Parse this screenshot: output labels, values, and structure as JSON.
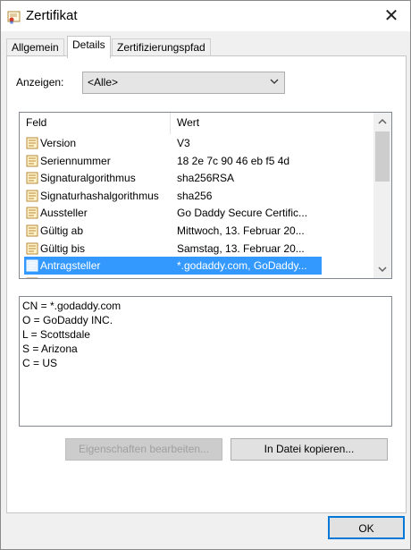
{
  "window": {
    "title": "Zertifikat",
    "close_glyph": "✕"
  },
  "tabs": [
    {
      "label": "Allgemein"
    },
    {
      "label": "Details"
    },
    {
      "label": "Zertifizierungspfad"
    }
  ],
  "show": {
    "label": "Anzeigen:",
    "selected": "<Alle>"
  },
  "list": {
    "headers": {
      "field": "Feld",
      "value": "Wert"
    },
    "rows": [
      {
        "field": "Version",
        "value": "V3"
      },
      {
        "field": "Seriennummer",
        "value": "18 2e 7c 90 46 eb f5 4d"
      },
      {
        "field": "Signaturalgorithmus",
        "value": "sha256RSA"
      },
      {
        "field": "Signaturhashalgorithmus",
        "value": "sha256"
      },
      {
        "field": "Aussteller",
        "value": "Go Daddy Secure Certific..."
      },
      {
        "field": "Gültig ab",
        "value": "Mittwoch, 13. Februar 20..."
      },
      {
        "field": "Gültig bis",
        "value": "Samstag, 13. Februar 20..."
      },
      {
        "field": "Antragsteller",
        "value": "*.godaddy.com, GoDaddy..."
      }
    ]
  },
  "details": {
    "lines": [
      "CN = *.godaddy.com",
      "O = GoDaddy INC.",
      "L = Scottsdale",
      "S = Arizona",
      "C = US"
    ]
  },
  "buttons": {
    "edit_properties": "Eigenschaften bearbeiten...",
    "copy_to_file": "In Datei kopieren...",
    "ok": "OK"
  },
  "colors": {
    "selection": "#3399ff",
    "focus_border": "#0078d7"
  }
}
